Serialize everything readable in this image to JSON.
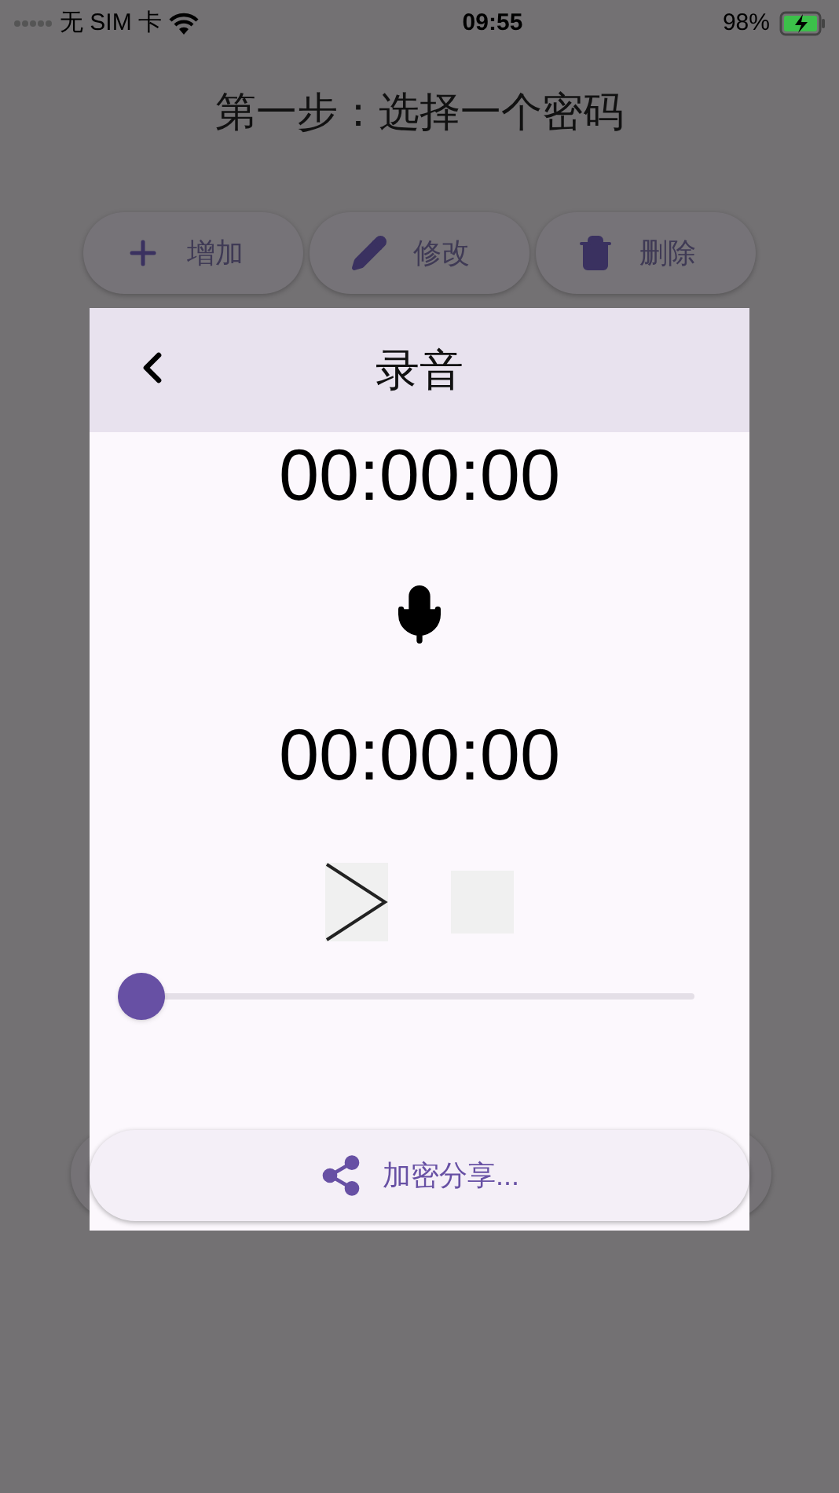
{
  "status_bar": {
    "carrier": "无 SIM 卡",
    "time": "09:55",
    "battery": "98%"
  },
  "page": {
    "title": "第一步：选择一个密码",
    "actions": [
      {
        "kind": "add",
        "label": "增加"
      },
      {
        "kind": "edit",
        "label": "修改"
      },
      {
        "kind": "delete",
        "label": "删除"
      }
    ]
  },
  "dialog": {
    "title": "录音",
    "record_time": "00:00:00",
    "play_time": "00:00:00",
    "progress": {
      "level": 0
    },
    "share_button": "加密分享..."
  }
}
